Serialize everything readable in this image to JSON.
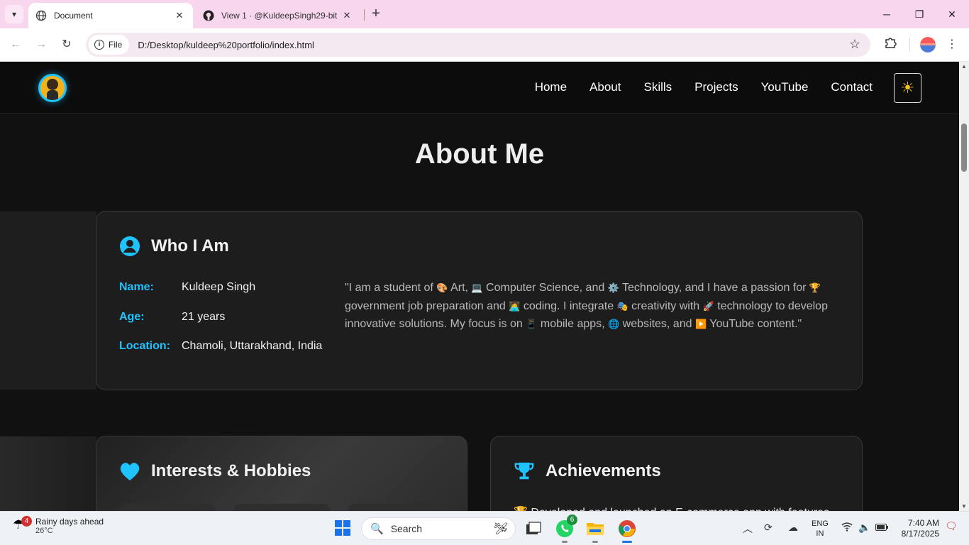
{
  "browser": {
    "tabs": [
      {
        "title": "Document",
        "active": true
      },
      {
        "title": "View 1 · @KuldeepSingh29-bit",
        "active": false
      }
    ],
    "url_scheme_label": "File",
    "url": "D:/Desktop/kuldeep%20portfolio/index.html"
  },
  "site": {
    "nav": [
      "Home",
      "About",
      "Skills",
      "Projects",
      "YouTube",
      "Contact"
    ],
    "section_title": "About Me",
    "who": {
      "heading": "Who I Am",
      "rows": [
        {
          "label": "Name:",
          "value": "Kuldeep Singh"
        },
        {
          "label": "Age:",
          "value": "21 years"
        },
        {
          "label": "Location:",
          "value": "Chamoli, Uttarakhand, India"
        }
      ],
      "quote": {
        "p1": "\"I am a student of ",
        "e1": "🎨",
        "p2": " Art, ",
        "e2": "💻",
        "p3": " Computer Science, and ",
        "e3": "⚙️",
        "p4": " Technology, and I have a passion for ",
        "e4": "🏆",
        "p5": " government job preparation and ",
        "e5": "👩‍💻",
        "p6": " coding. I integrate ",
        "e6": "🎭",
        "p7": " creativity with ",
        "e7": "🚀",
        "p8": " technology to develop innovative solutions. My focus is on ",
        "e8": "📱",
        "p9": " mobile apps, ",
        "e9": "🌐",
        "p10": " websites, and ",
        "e10": "▶️",
        "p11": " YouTube content.\""
      }
    },
    "interests": {
      "heading": "Interests & Hobbies"
    },
    "achievements": {
      "heading": "Achievements",
      "first_item": "🏆 Developed and launched an E-commerce app with features"
    }
  },
  "taskbar": {
    "weather_badge": "4",
    "weather_title": "Rainy days ahead",
    "weather_temp": "26°C",
    "search_placeholder": "Search",
    "whatsapp_badge": "6",
    "lang_line1": "ENG",
    "lang_line2": "IN",
    "time": "7:40 AM",
    "date": "8/17/2025"
  },
  "colors": {
    "accent": "#1ec3ff",
    "page_bg": "#111111",
    "card_bg": "#1d1d1d",
    "tabbar_bg": "#f7d6ee",
    "theme_icon": "#f6c41a"
  },
  "icons": {
    "theme_toggle": "sun-icon",
    "who_heading": "user-circle-icon",
    "interests_heading": "heart-icon",
    "achievements_heading": "trophy-icon"
  }
}
